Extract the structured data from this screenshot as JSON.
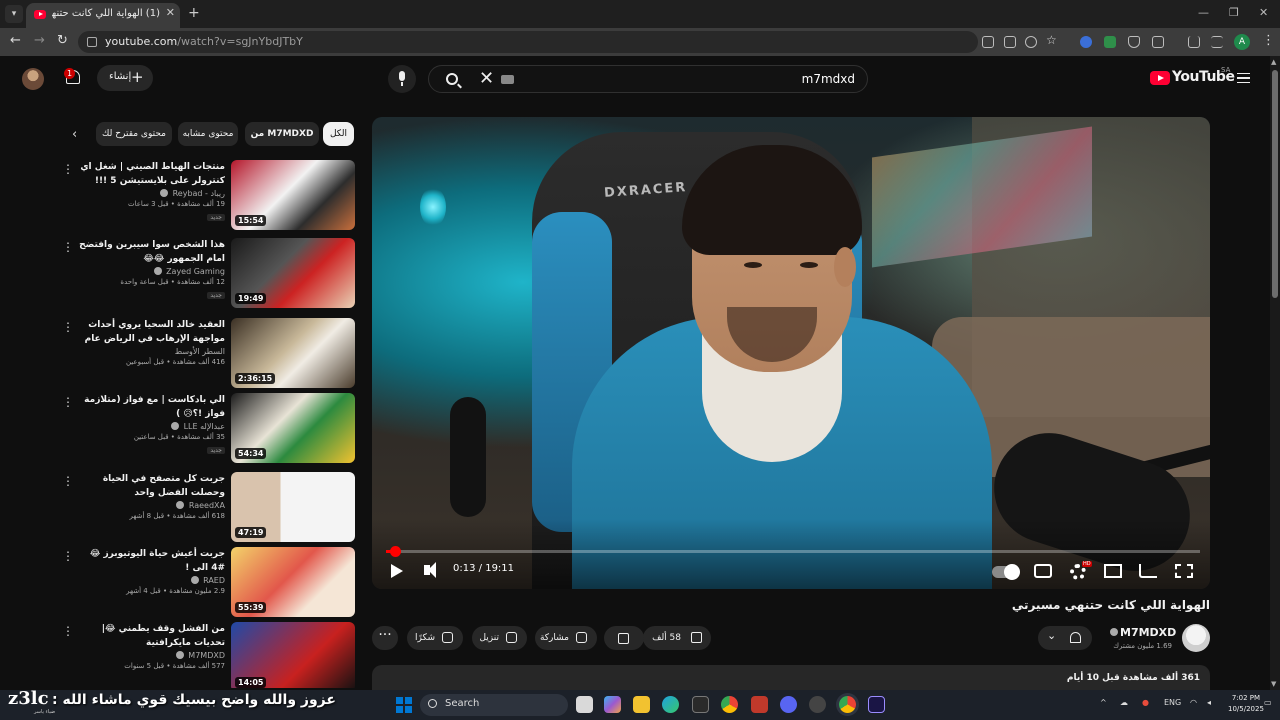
{
  "browser": {
    "tab_title": "(1) الهواية اللي كانت حتنهي مسيرتي",
    "url_host": "youtube.com",
    "url_path": "/watch?v=sgJnYbdJTbY",
    "profile_initial": "A"
  },
  "header": {
    "notification_count": "1",
    "create_label": "إنشاء",
    "search_query": "m7mdxd",
    "logo_text": "YouTube",
    "region": "SA"
  },
  "chips": [
    "الكل",
    "من M7MDXD",
    "محتوى مشابه",
    "محتوى مقترح لك"
  ],
  "recommendations": [
    {
      "title": "منتجات الهياط الصيني | شغل اي كنترولر على بلايستيشن 5 !!!",
      "channel": "ريباد - Reybad",
      "views": "19 ألف مشاهدة • قبل 3 ساعات",
      "badge": "جديد",
      "duration": "15:54"
    },
    {
      "title": "هذا الشخص سوا سيبرين وافتضح امام الجمهور 😂😂",
      "channel": "Zayed Gaming",
      "views": "12 ألف مشاهدة • قبل ساعة واحدة",
      "badge": "جديد",
      "duration": "19:49"
    },
    {
      "title": "العقيد خالد السحيا يروي أحداث مواجهة الإرهاب في الرياض عام 2003",
      "channel": "السطر الأوسط",
      "views": "416 ألف مشاهدة • قبل أسبوعين",
      "badge": "",
      "duration": "2:36:15"
    },
    {
      "title": "الي بادكاست | مع فواز (متلازمة فواز !؟😥 )",
      "channel": "عبدالإله LLE",
      "views": "35 ألف مشاهدة • قبل ساعتين",
      "badge": "جديد",
      "duration": "54:34"
    },
    {
      "title": "جربت كل متصفح في الحياة وحصلت الفضل واحد",
      "channel": "RaeedXA",
      "views": "618 ألف مشاهدة • قبل 8 أشهر",
      "badge": "",
      "duration": "47:19"
    },
    {
      "title": "جربت أعيش حياة اليوتيوبرز 😂 #4 الى !",
      "channel": "RAED",
      "views": "2.9 مليون مشاهدة • قبل 4 أشهر",
      "badge": "",
      "duration": "55:39"
    },
    {
      "title": "من الفشل وقف يطمني 😂| تحديات مايكرافتية",
      "channel": "M7MDXD",
      "views": "577 ألف مشاهدة • قبل 5 سنوات",
      "badge": "",
      "duration": "14:05"
    }
  ],
  "player": {
    "current_time": "0:13",
    "total_time": "19:11",
    "progress": 0.011,
    "hd_badge": "HD",
    "chair_brand": "DXRACER"
  },
  "video": {
    "title": "الهواية اللي كانت حتنهي مسيرتي",
    "channel": "M7MDXD",
    "subscribers": "1.69 مليون مشترك",
    "likes": "58 ألف",
    "share_label": "مشاركة",
    "download_label": "تنزيل",
    "thanks_label": "شكرًا",
    "description_views": "361 ألف مشاهدة قبل 10 أيام"
  },
  "overlay": {
    "brand": "z3lc",
    "brand_sub": "ضياء ياسر",
    "message": "عزوز والله واضح بيسيك قوي ماشاء الله :"
  },
  "taskbar": {
    "search_label": "Search",
    "lang": "ENG",
    "time": "7:02 PM",
    "date": "10/5/2025"
  },
  "colors": {
    "accent": "#ff0033",
    "background": "#0f0f0f",
    "surface": "#272727"
  }
}
